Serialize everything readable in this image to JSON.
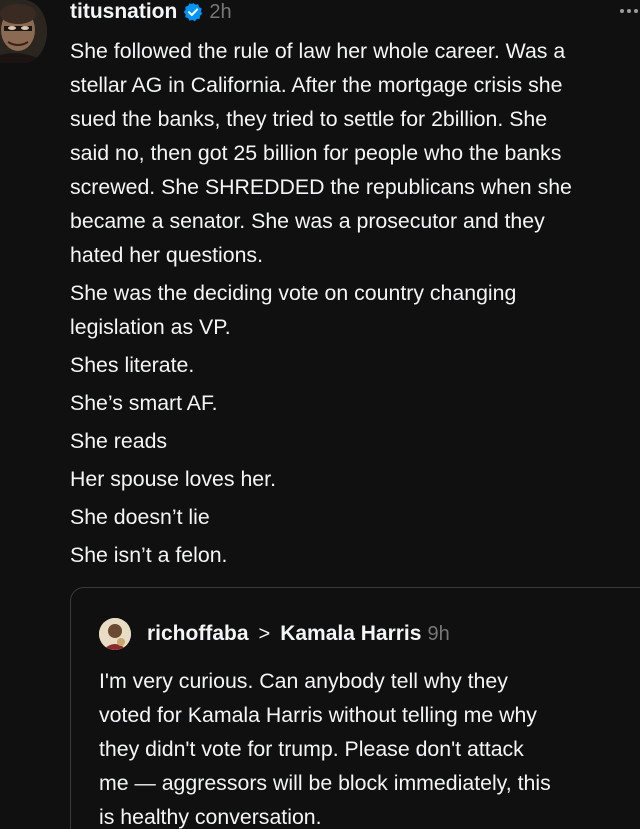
{
  "post": {
    "username": "titusnation",
    "time": "2h",
    "lines": [
      "She followed the rule of law her whole career. Was a",
      "stellar AG in California. After the mortgage crisis she",
      "sued the banks, they tried to settle for 2billion. She",
      "said no, then got 25 billion for people who the banks",
      "screwed. She SHREDDED the republicans when she",
      "became a senator. She was a prosecutor and they",
      "hated her questions.",
      "She was the deciding vote on country changing",
      "legislation as VP.",
      "Shes literate.",
      "She’s smart AF.",
      "She reads",
      "Her spouse loves her.",
      "She doesn’t lie",
      "She isn’t a felon."
    ]
  },
  "quote": {
    "username": "richoffaba",
    "chevron": ">",
    "target": "Kamala Harris",
    "time": "9h",
    "lines": [
      "I'm very curious. Can anybody tell why they",
      "voted for Kamala Harris without telling me why",
      "they didn't vote for trump. Please don't attack",
      "me — aggressors will be block immediately, this",
      "is healthy conversation."
    ]
  },
  "colors": {
    "background": "#101010",
    "text": "#f3f5f7",
    "muted": "#777777",
    "verified": "#0095f6",
    "border": "#3a3a3a"
  },
  "icons": {
    "verified": "verified-badge-icon",
    "more": "more-options-icon"
  }
}
